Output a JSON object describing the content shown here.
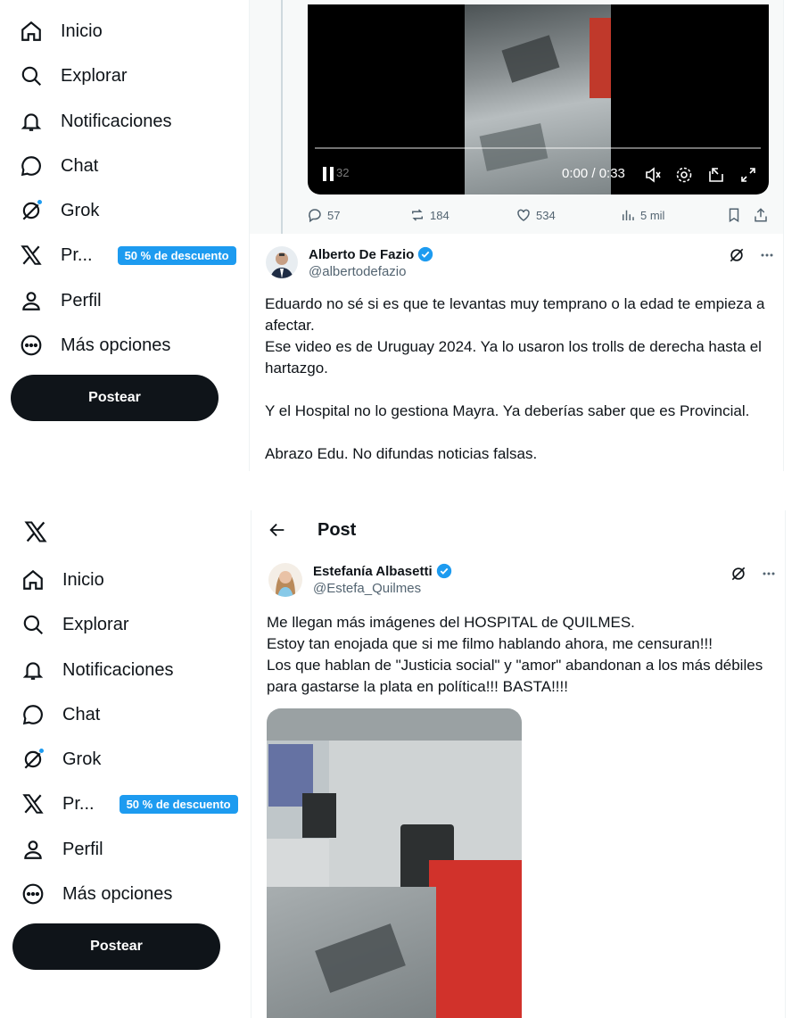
{
  "nav_items": {
    "home": "Inicio",
    "explore": "Explorar",
    "notifications": "Notificaciones",
    "chat": "Chat",
    "grok": "Grok",
    "premium": "Pr...",
    "premium_promo": "50 % de descuento",
    "profile": "Perfil",
    "more": "Más opciones"
  },
  "post_button": "Postear",
  "reply_panel": {
    "video": {
      "current_time": "0:00 / 0:33",
      "left_time_fragment": "32",
      "progress": 0
    },
    "stats": {
      "replies": "57",
      "reposts": "184",
      "likes": "534",
      "views": "5 mil"
    },
    "reply": {
      "author_name": "Alberto De Fazio",
      "author_handle": "@albertodefazio",
      "paragraphs": [
        "Eduardo no sé si es que te levantas muy temprano o la edad te empieza a afectar.",
        "Ese video es de Uruguay 2024. Ya lo usaron los trolls de derecha hasta el hartazgo.",
        "Y el Hospital no lo gestiona Mayra. Ya deberías saber que es Provincial.",
        "Abrazo Edu. No difundas noticias falsas."
      ]
    }
  },
  "post_panel": {
    "header_title": "Post",
    "post": {
      "author_name": "Estefanía Albasetti",
      "author_handle": "@Estefa_Quilmes",
      "lines": [
        "Me llegan más imágenes del HOSPITAL de QUILMES.",
        "Estoy tan enojada que si me filmo hablando ahora, me censuran!!!",
        "Los que hablan de \"Justicia social\" y \"amor\" abandonan a los más débiles para gastarse la plata en política!!! BASTA!!!!"
      ]
    }
  },
  "colors": {
    "accent": "#1d9bf0",
    "text": "#0f1419",
    "muted": "#536471",
    "button_bg": "#0f1419"
  },
  "icons": [
    "home-icon",
    "search-icon",
    "bell-icon",
    "chat-icon",
    "grok-icon",
    "x-logo-icon",
    "person-icon",
    "more-circle-icon",
    "reply-icon",
    "repost-icon",
    "like-icon",
    "views-icon",
    "bookmark-icon",
    "share-icon",
    "verified-badge-icon",
    "back-arrow-icon",
    "more-dots-icon",
    "mute-icon",
    "settings-icon",
    "pip-icon",
    "fullscreen-icon",
    "pause-icon"
  ]
}
